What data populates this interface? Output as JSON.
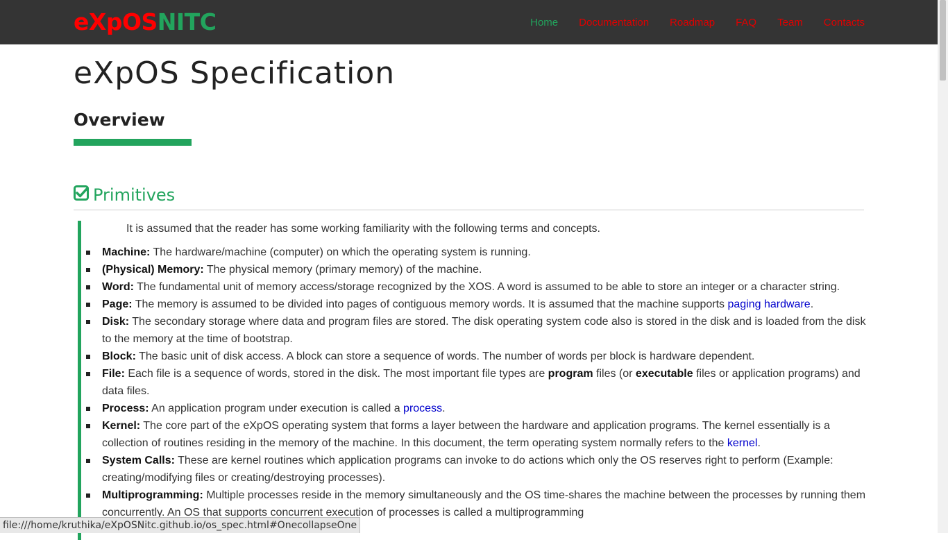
{
  "brand": {
    "part1": "eXpOS",
    "part2": "NITC"
  },
  "nav": [
    {
      "label": "Home",
      "active": true
    },
    {
      "label": "Documentation",
      "active": false
    },
    {
      "label": "Roadmap",
      "active": false
    },
    {
      "label": "FAQ",
      "active": false
    },
    {
      "label": "Team",
      "active": false
    },
    {
      "label": "Contacts",
      "active": false
    }
  ],
  "page_title": "eXpOS Specification",
  "overview_heading": "Overview",
  "section": {
    "icon": "check-square-icon",
    "title": "Primitives"
  },
  "intro": "It is assumed that the reader has some working familiarity with the following terms and concepts.",
  "terms": [
    {
      "term": "Machine:",
      "text": " The hardware/machine (computer) on which the operating system is running."
    },
    {
      "term": "(Physical) Memory:",
      "text": " The physical memory (primary memory) of the machine."
    },
    {
      "term": "Word:",
      "text": " The fundamental unit of memory access/storage recognized by the XOS. A word is assumed to be able to store an integer or a character string."
    },
    {
      "term": "Page:",
      "text": " The memory is assumed to be divided into pages of contiguous memory words. It is assumed that the machine supports ",
      "link": "paging hardware",
      "after": "."
    },
    {
      "term": "Disk:",
      "text": " The secondary storage where data and program files are stored. The disk operating system code also is stored in the disk and is loaded from the disk to the memory at the time of bootstrap."
    },
    {
      "term": "Block:",
      "text": " The basic unit of disk access. A block can store a sequence of words. The number of words per block is hardware dependent."
    },
    {
      "term": "File:",
      "text": " Each file is a sequence of words, stored in the disk. The most important file types are ",
      "bold1": "program",
      "mid": " files (or ",
      "bold2": "executable",
      "after": " files or application programs) and data files."
    },
    {
      "term": "Process:",
      "text": " An application program under execution is called a ",
      "link": "process",
      "after": "."
    },
    {
      "term": "Kernel:",
      "text": " The core part of the eXpOS operating system that forms a layer between the hardware and application programs. The kernel essentially is a collection of routines residing in the memory of the machine. In this document, the term operating system normally refers to the ",
      "link": "kernel",
      "after": "."
    },
    {
      "term": "System Calls:",
      "text": " These are kernel routines which application programs can invoke to do actions which only the OS reserves right to perform (Example: creating/modifying files or creating/destroying processes)."
    },
    {
      "term": "Multiprogramming:",
      "text": " Multiple processes reside in the memory simultaneously and the OS time-shares the machine between the processes by running them concurrently. An OS that supports concurrent execution of processes is called a multiprogramming"
    }
  ],
  "status_url": "file:///home/kruthika/eXpOSNitc.github.io/os_spec.html#OnecollapseOne",
  "colors": {
    "accent_green": "#22a45d",
    "nav_red": "#e00000",
    "navbar_bg": "#343434",
    "link_blue": "#0000cc"
  }
}
